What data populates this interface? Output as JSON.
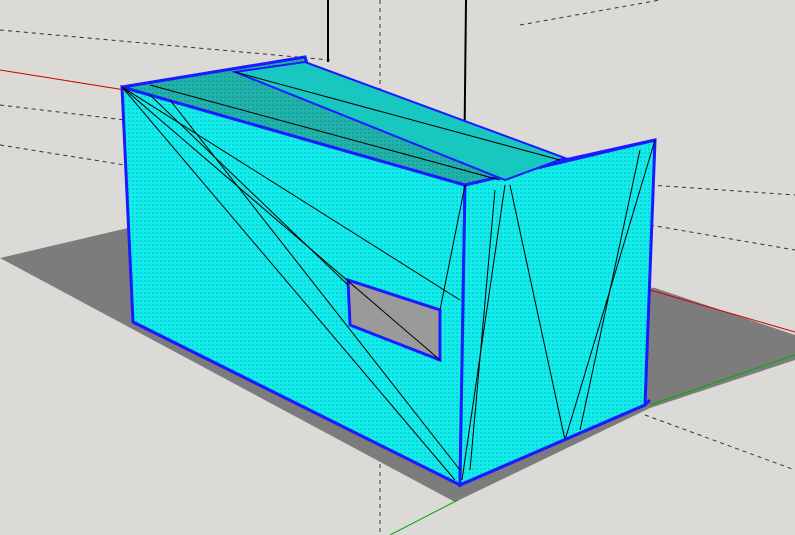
{
  "viewport": {
    "type": "3d-model-view",
    "colors": {
      "background": "#dcdad6",
      "shadow": "#7c7c7c",
      "face_front": "#12e8e8",
      "face_side": "#14f0f0",
      "roof": "#1fb3ab",
      "window": "#9a9a9a",
      "edge_selected": "#1a1aff",
      "axis_red": "#cc0000",
      "axis_green": "#00aa00"
    }
  }
}
